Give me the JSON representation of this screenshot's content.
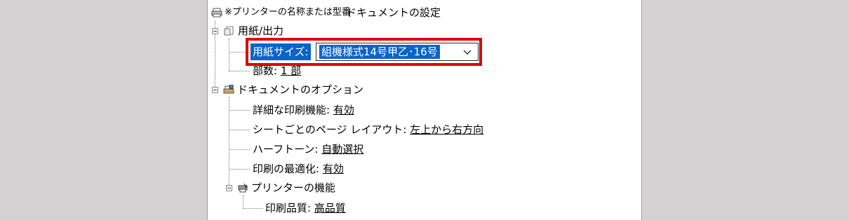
{
  "header": {
    "printer_prefix": "※プリンターの名称または型番",
    "title": "ドキュメントの設定"
  },
  "tree": {
    "paper_output": {
      "label": "用紙/出力",
      "paper_size": {
        "label": "用紙サイズ:",
        "value": "組機様式14号甲乙･16号"
      },
      "copies": {
        "label": "部数:",
        "value": "1 部"
      }
    },
    "document_options": {
      "label": "ドキュメントのオプション",
      "items": [
        {
          "label": "詳細な印刷機能:",
          "value": "有効"
        },
        {
          "label": "シートごとのページ レイアウト:",
          "value": "左上から右方向"
        },
        {
          "label": "ハーフトーン:",
          "value": "自動選択"
        },
        {
          "label": "印刷の最適化:",
          "value": "有効"
        }
      ],
      "printer_features": {
        "label": "プリンターの機能",
        "quality": {
          "label": "印刷品質:",
          "value": "高品質"
        }
      }
    }
  },
  "colors": {
    "selection": "#0a64c9",
    "highlight_border": "#e00000",
    "background": "#d3d1d1"
  }
}
